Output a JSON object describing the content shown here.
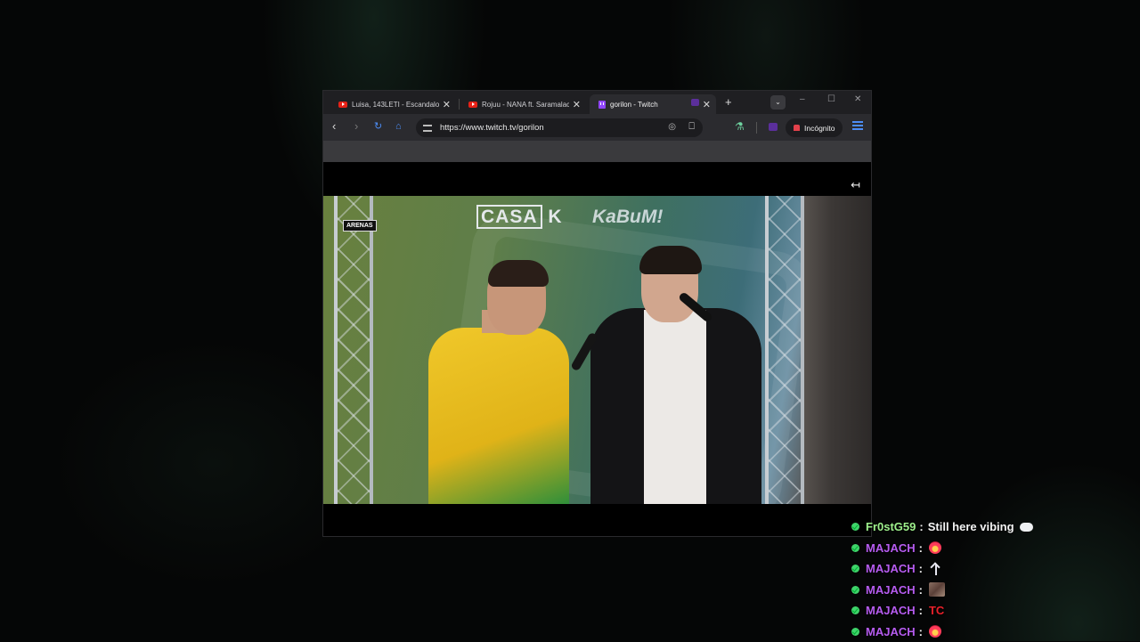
{
  "browser": {
    "tabs": [
      {
        "title": "Luisa, 143LETI - Escandalo (",
        "icon": "youtube-icon",
        "active": false
      },
      {
        "title": "Rojuu - NANA ft. Saramalac",
        "icon": "youtube-icon",
        "active": false
      },
      {
        "title": "gorilon - Twitch",
        "icon": "twitch-icon",
        "active": true
      }
    ],
    "new_tab_label": "+",
    "tab_search_label": "⌄",
    "window_controls": {
      "minimize": "–",
      "maximize": "☐",
      "close": "✕"
    },
    "url": "https://www.twitch.tv/gorilon",
    "incognito_label": "Incógnito"
  },
  "stream": {
    "collapse_label": "↤",
    "overlay_logos": {
      "casa": "CASA",
      "casa_k": "K",
      "kabum": "KaBuM!",
      "arenas": "ARENAS"
    }
  },
  "chat": {
    "colors": {
      "badge": "#3fd46a",
      "name_green": "#9ef08c",
      "name_purple": "#b65cf0"
    },
    "messages": [
      {
        "user": "Fr0stG59",
        "text": "Still here vibing",
        "emote": "cloud",
        "name_color": "#9ef08c"
      },
      {
        "user": "MAJACH",
        "text": "",
        "emote": "fire",
        "name_color": "#b65cf0"
      },
      {
        "user": "MAJACH",
        "text": "",
        "emote": "arrow",
        "name_color": "#b65cf0"
      },
      {
        "user": "MAJACH",
        "text": "",
        "emote": "photo",
        "name_color": "#b65cf0"
      },
      {
        "user": "MAJACH",
        "text": "",
        "emote": "tc",
        "emote_text": "TC",
        "name_color": "#b65cf0"
      },
      {
        "user": "MAJACH",
        "text": "",
        "emote": "fire",
        "name_color": "#b65cf0"
      }
    ],
    "separator": ":"
  }
}
